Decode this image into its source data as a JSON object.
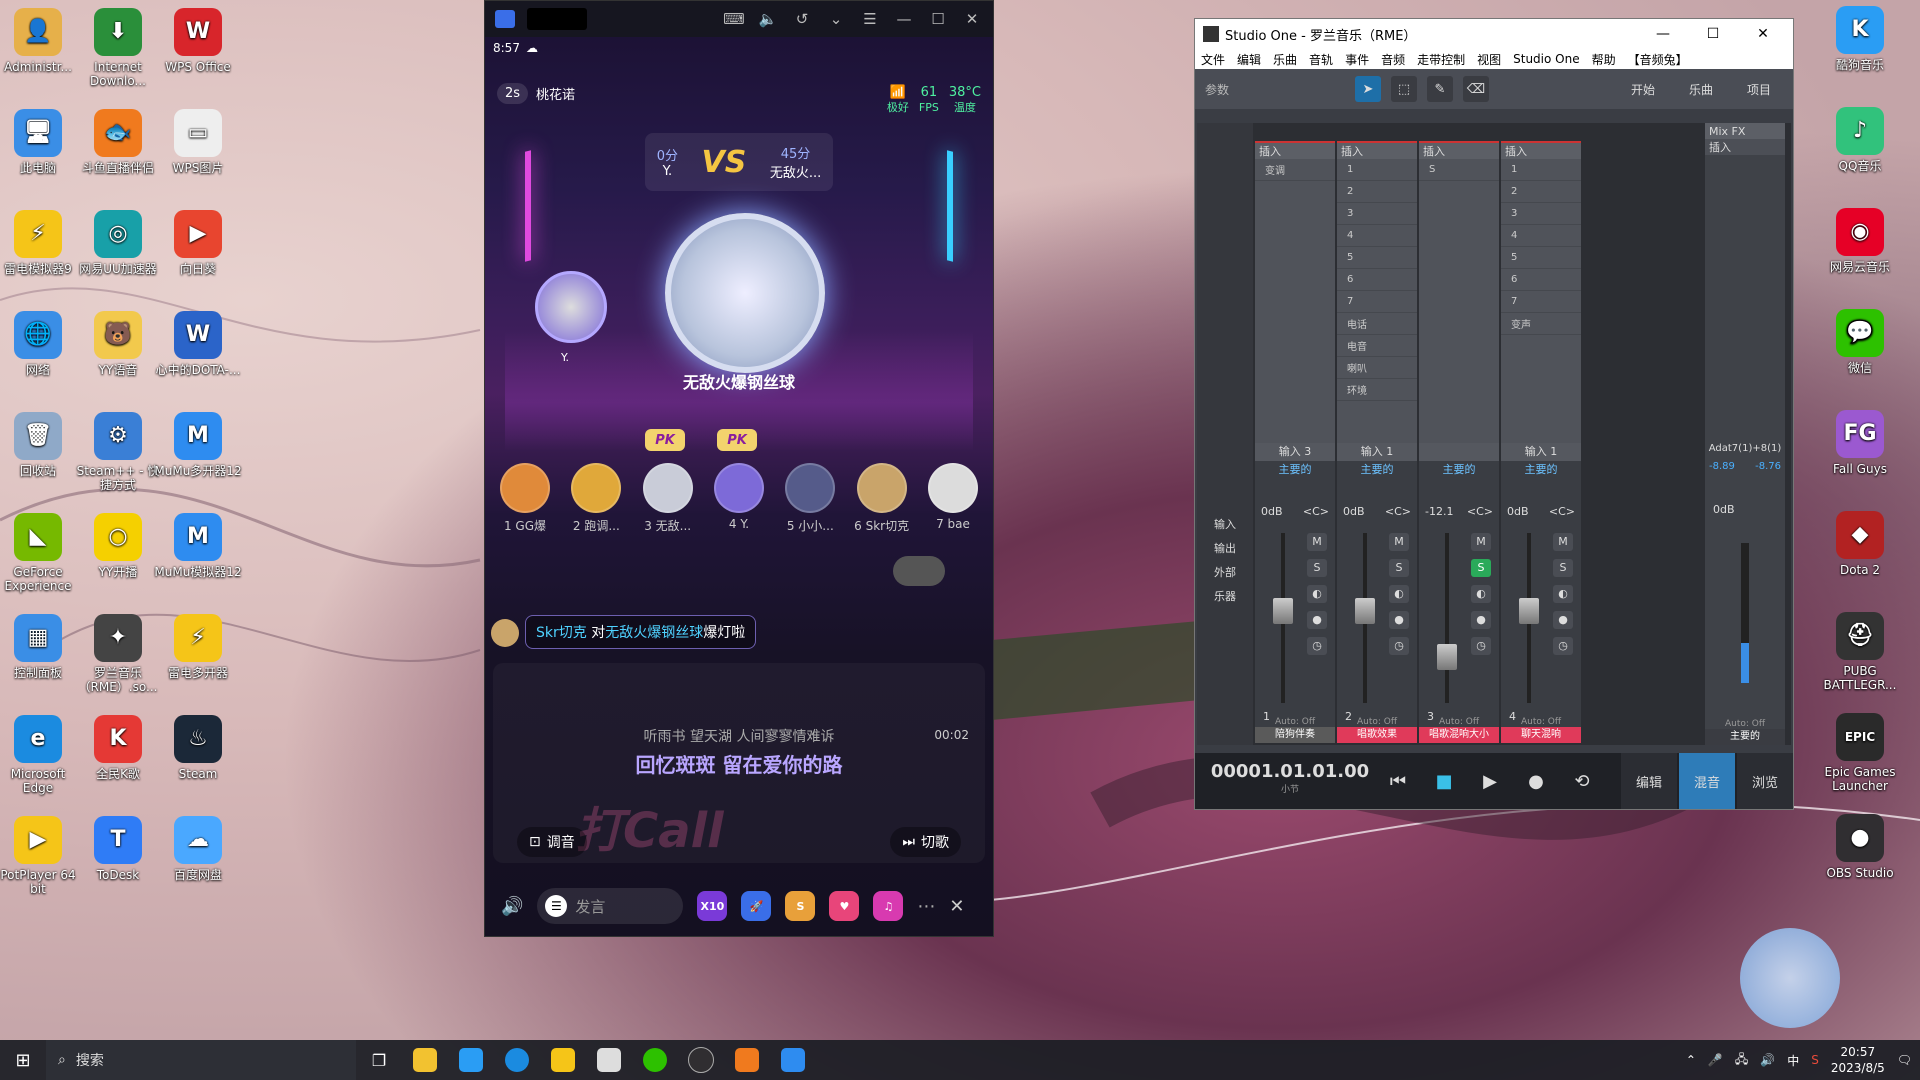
{
  "desktop": {
    "icons": [
      {
        "label": "Administr...",
        "color": "#e6b04a",
        "glyph": "👤"
      },
      {
        "label": "Internet Downlo...",
        "color": "#2a8f3a",
        "glyph": "⬇"
      },
      {
        "label": "WPS Office",
        "color": "#d8252b",
        "glyph": "W"
      },
      {
        "label": "此电脑",
        "color": "#3a8ee6",
        "glyph": "🖥"
      },
      {
        "label": "斗鱼直播伴侣",
        "color": "#f07a1e",
        "glyph": "🐟"
      },
      {
        "label": "WPS图片",
        "color": "#eeeeee",
        "glyph": "▭"
      },
      {
        "label": "雷电模拟器9",
        "color": "#f5c518",
        "glyph": "⚡"
      },
      {
        "label": "网易UU加速器",
        "color": "#18a0a8",
        "glyph": "◎"
      },
      {
        "label": "向日葵",
        "color": "#e8452f",
        "glyph": "▶"
      },
      {
        "label": "网络",
        "color": "#3a8ee6",
        "glyph": "🌐"
      },
      {
        "label": "YY语音",
        "color": "#f2c94c",
        "glyph": "🐻"
      },
      {
        "label": "心中的DOTA-...",
        "color": "#2b64c9",
        "glyph": "W"
      },
      {
        "label": "回收站",
        "color": "#8fa9c8",
        "glyph": "🗑"
      },
      {
        "label": "Steam++ - 快捷方式",
        "color": "#3a7fd6",
        "glyph": "⚙"
      },
      {
        "label": "MuMu多开器12",
        "color": "#2e8cf0",
        "glyph": "M"
      },
      {
        "label": "GeForce Experience",
        "color": "#76b900",
        "glyph": "◣"
      },
      {
        "label": "YY开播",
        "color": "#f5d000",
        "glyph": "○"
      },
      {
        "label": "MuMu模拟器12",
        "color": "#2e8cf0",
        "glyph": "M"
      },
      {
        "label": "控制面板",
        "color": "#3a8ee6",
        "glyph": "▦"
      },
      {
        "label": "罗兰音乐（RME）.so...",
        "color": "#444444",
        "glyph": "✦"
      },
      {
        "label": "雷电多开器",
        "color": "#f5c518",
        "glyph": "⚡"
      },
      {
        "label": "Microsoft Edge",
        "color": "#1b8be0",
        "glyph": "e"
      },
      {
        "label": "全民K歌",
        "color": "#e53935",
        "glyph": "K"
      },
      {
        "label": "Steam",
        "color": "#1b2838",
        "glyph": "♨"
      },
      {
        "label": "PotPlayer 64 bit",
        "color": "#f5c518",
        "glyph": "▶"
      },
      {
        "label": "ToDesk",
        "color": "#2f7cf6",
        "glyph": "T"
      },
      {
        "label": "百度网盘",
        "color": "#4aa8ff",
        "glyph": "☁"
      }
    ],
    "right_icons": [
      {
        "label": "酷狗音乐",
        "color": "#2a9df4",
        "glyph": "K"
      },
      {
        "label": "QQ音乐",
        "color": "#31c27c",
        "glyph": "♪"
      },
      {
        "label": "网易云音乐",
        "color": "#e60026",
        "glyph": "◉"
      },
      {
        "label": "微信",
        "color": "#2dc100",
        "glyph": "💬"
      },
      {
        "label": "Fall Guys",
        "color": "#9b59d0",
        "glyph": "FG"
      },
      {
        "label": "Dota 2",
        "color": "#b22222",
        "glyph": "◆"
      },
      {
        "label": "PUBG BATTLEGR...",
        "color": "#333333",
        "glyph": "⛑"
      },
      {
        "label": "Epic Games Launcher",
        "color": "#2a2a2a",
        "glyph": "EPIC"
      },
      {
        "label": "OBS Studio",
        "color": "#302e31",
        "glyph": "●"
      }
    ]
  },
  "phone": {
    "status_time": "8:57",
    "room_timer": "2s",
    "room_name": "桃花诺",
    "net_value": "61",
    "net_quality": "极好",
    "fps_label": "FPS",
    "temp_value": "38°C",
    "temp_label": "温度",
    "vs_left_score": "0分",
    "vs_left_name": "Y.",
    "vs_label": "VS",
    "vs_right_score": "45分",
    "vs_right_name": "无敌火...",
    "stage_name": "无敌火爆钢丝球",
    "side_avatar_name": "Y.",
    "pk_tag": "PK",
    "seats": [
      {
        "label": "1 GG爆",
        "color": "#e08a3a"
      },
      {
        "label": "2 跑调...",
        "color": "#e0a83a"
      },
      {
        "label": "3 无敌...",
        "color": "#c9ccd8"
      },
      {
        "label": "4 Y.",
        "color": "#7d6ad8"
      },
      {
        "label": "5 小小...",
        "color": "#555b8a"
      },
      {
        "label": "6 Skr切克",
        "color": "#c9a46a"
      },
      {
        "label": "7 bae",
        "color": "#dcdcdc"
      }
    ],
    "msg_user": "Skr切克",
    "msg_mid": " 对",
    "msg_target": "无敌火爆钢丝球",
    "msg_action": "爆灯啦",
    "lyric_prev": "听雨书 望天湖 人间寥寥情难诉",
    "lyric_current": "回忆斑斑 留在爱你的路",
    "lyric_time": "00:02",
    "tune_label": "调音",
    "switch_label": "切歌",
    "say_placeholder": "发言",
    "gift_count": "X10"
  },
  "studio": {
    "title": "Studio One - 罗兰音乐（RME）",
    "menu": [
      "文件",
      "编辑",
      "乐曲",
      "音轨",
      "事件",
      "音频",
      "走带控制",
      "视图",
      "Studio One",
      "帮助",
      "【音频兔】"
    ],
    "params_label": "参数",
    "toolbar_right": [
      "开始",
      "乐曲",
      "项目"
    ],
    "insert_label": "插入",
    "mixfx_label": "Mix FX",
    "channels": [
      {
        "input": "输入 3",
        "bus": "主要的",
        "vol": "0dB",
        "pan": "<C>",
        "num": "1",
        "label": "陪狗伴奏",
        "label_color": "#5a5a5a",
        "slots": [
          "变调"
        ],
        "fader": 0.62,
        "solo_on": false
      },
      {
        "input": "输入 1",
        "bus": "主要的",
        "vol": "0dB",
        "pan": "<C>",
        "num": "2",
        "label": "唱歌效果",
        "label_color": "#e03a5a",
        "slots": [
          "1",
          "2",
          "3",
          "4",
          "5",
          "6",
          "7",
          "电话",
          "电音",
          "喇叭",
          "环境"
        ],
        "fader": 0.62,
        "solo_on": false
      },
      {
        "input": "",
        "bus": "主要的",
        "vol": "-12.1",
        "pan": "<C>",
        "num": "3",
        "label": "唱歌混响大小",
        "label_color": "#e03a5a",
        "slots": [
          "S"
        ],
        "fader": 0.35,
        "solo_on": true
      },
      {
        "input": "输入 1",
        "bus": "主要的",
        "vol": "0dB",
        "pan": "<C>",
        "num": "4",
        "label": "聊天混响",
        "label_color": "#e03a5a",
        "slots": [
          "1",
          "2",
          "3",
          "4",
          "5",
          "6",
          "7",
          "变声"
        ],
        "fader": 0.62,
        "solo_on": false
      }
    ],
    "master": {
      "name": "Adat7(1)+8(1)",
      "peak_l": "-8.89",
      "peak_r": "-8.76",
      "vol": "0dB",
      "label": "主要的"
    },
    "side_labels": [
      "输入",
      "输出",
      "外部",
      "乐器"
    ],
    "auto_off": "Auto: Off",
    "fx_label": "FX",
    "time": "00001.01.01.00",
    "time_unit": "小节",
    "tabs": [
      "编辑",
      "混音",
      "浏览"
    ]
  },
  "taskbar": {
    "search_placeholder": "搜索",
    "time": "20:57",
    "date": "2023/8/5",
    "ime": "中"
  }
}
